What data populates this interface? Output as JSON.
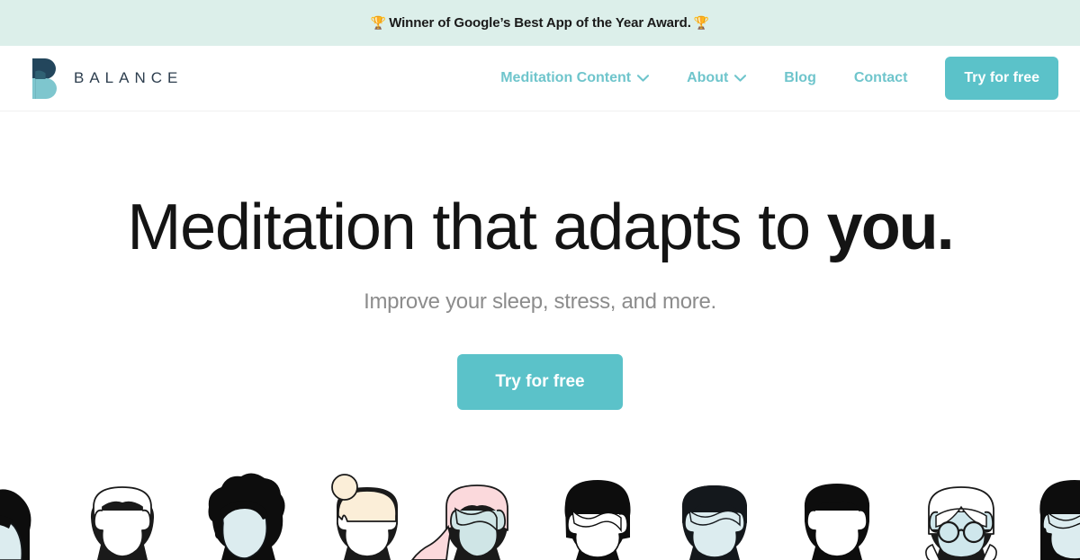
{
  "banner": {
    "icon_left": "trophy-icon",
    "icon_right": "trophy-icon",
    "trophy_glyph": "🏆",
    "text": "Winner of Google’s Best App of the Year Award."
  },
  "header": {
    "logo": {
      "mark_name": "balance-b-logo-icon",
      "wordmark": "BALANCE",
      "mark_top_color": "#23465c",
      "mark_bottom_color": "#7ec6ce"
    },
    "nav": [
      {
        "label": "Meditation Content",
        "has_dropdown": true
      },
      {
        "label": "About",
        "has_dropdown": true
      },
      {
        "label": "Blog",
        "has_dropdown": false
      },
      {
        "label": "Contact",
        "has_dropdown": false
      }
    ],
    "cta_label": "Try for free"
  },
  "hero": {
    "title_main": "Meditation that adapts to ",
    "title_accent": "you.",
    "subtitle": "Improve your sleep, stress, and more.",
    "cta_label": "Try for free"
  },
  "colors": {
    "banner_bg": "#dcefea",
    "teal_accent": "#5bc2c9",
    "nav_teal": "#6fc5cc",
    "headline": "#141414",
    "subtitle_grey": "#8c8c8c",
    "logo_navy": "#23465c"
  },
  "avatars": [
    {
      "name": "avatar-curly-dark-hair",
      "hair": "#0d0d0d",
      "face": "#dcecef"
    },
    {
      "name": "avatar-outline-short-hair",
      "hair": "#ffffff",
      "face": "#ffffff"
    },
    {
      "name": "avatar-afro-dark-hair",
      "hair": "#0d0d0d",
      "face": "#dcecef"
    },
    {
      "name": "avatar-bun-cream-hair",
      "hair": "#fbeed8",
      "face": "#ffffff"
    },
    {
      "name": "avatar-long-pink-hair",
      "hair": "#fbd9dc",
      "face": "#cfe5e6"
    },
    {
      "name": "avatar-black-bob",
      "hair": "#0d0d0d",
      "face": "#ffffff"
    },
    {
      "name": "avatar-short-dark-hair",
      "hair": "#14181c",
      "face": "#dcecef"
    },
    {
      "name": "avatar-dark-crop-hair",
      "hair": "#0d0d0d",
      "face": "#ffffff"
    },
    {
      "name": "avatar-glasses-white-hair",
      "hair": "#ffffff",
      "face": "#cfe7ec"
    },
    {
      "name": "avatar-long-black-hair",
      "hair": "#0d0d0d",
      "face": "#dcecef"
    }
  ]
}
